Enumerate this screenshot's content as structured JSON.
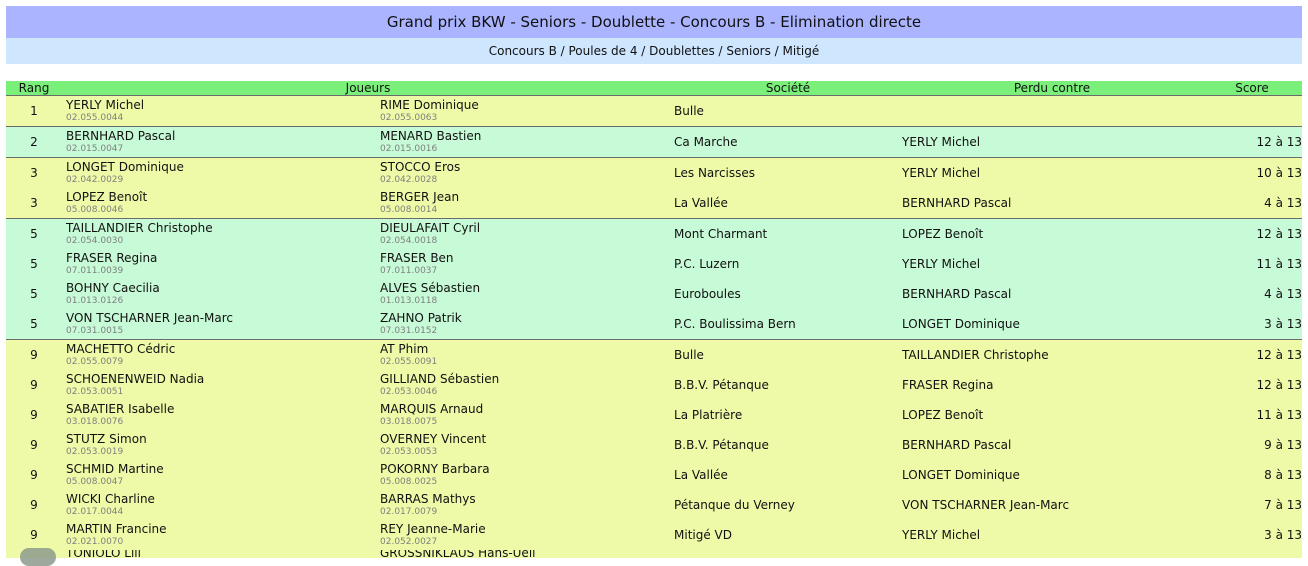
{
  "header": {
    "title": "Grand prix BKW - Seniors - Doublette - Concours B - Elimination directe",
    "subtitle": "Concours B / Poules de 4 / Doublettes / Seniors / Mitigé"
  },
  "columns": {
    "rank": "Rang",
    "players": "Joueurs",
    "club": "Société",
    "lost_to": "Perdu contre",
    "score": "Score"
  },
  "rows": [
    {
      "rank": "1",
      "p1": "YERLY Michel",
      "l1": "02.055.0044",
      "p2": "RIME Dominique",
      "l2": "02.055.0063",
      "club": "Bulle",
      "lost_to": "",
      "score": ""
    },
    {
      "rank": "2",
      "p1": "BERNHARD Pascal",
      "l1": "02.015.0047",
      "p2": "MENARD Bastien",
      "l2": "02.015.0016",
      "club": "Ca Marche",
      "lost_to": "YERLY Michel",
      "score": "12 à 13"
    },
    {
      "rank": "3",
      "p1": "LONGET Dominique",
      "l1": "02.042.0029",
      "p2": "STOCCO Eros",
      "l2": "02.042.0028",
      "club": "Les Narcisses",
      "lost_to": "YERLY Michel",
      "score": "10 à 13"
    },
    {
      "rank": "3",
      "p1": "LOPEZ Benoît",
      "l1": "05.008.0046",
      "p2": "BERGER Jean",
      "l2": "05.008.0014",
      "club": "La Vallée",
      "lost_to": "BERNHARD Pascal",
      "score": "4 à 13"
    },
    {
      "rank": "5",
      "p1": "TAILLANDIER Christophe",
      "l1": "02.054.0030",
      "p2": "DIEULAFAIT Cyril",
      "l2": "02.054.0018",
      "club": "Mont Charmant",
      "lost_to": "LOPEZ Benoît",
      "score": "12 à 13"
    },
    {
      "rank": "5",
      "p1": "FRASER Regina",
      "l1": "07.011.0039",
      "p2": "FRASER Ben",
      "l2": "07.011.0037",
      "club": "P.C. Luzern",
      "lost_to": "YERLY Michel",
      "score": "11 à 13"
    },
    {
      "rank": "5",
      "p1": "BOHNY Caecilia",
      "l1": "01.013.0126",
      "p2": "ALVES Sébastien",
      "l2": "01.013.0118",
      "club": "Euroboules",
      "lost_to": "BERNHARD Pascal",
      "score": "4 à 13"
    },
    {
      "rank": "5",
      "p1": "VON TSCHARNER Jean-Marc",
      "l1": "07.031.0015",
      "p2": "ZAHNO Patrik",
      "l2": "07.031.0152",
      "club": "P.C. Boulissima Bern",
      "lost_to": "LONGET Dominique",
      "score": "3 à 13"
    },
    {
      "rank": "9",
      "p1": "MACHETTO Cédric",
      "l1": "02.055.0079",
      "p2": "AT Phim",
      "l2": "02.055.0091",
      "club": "Bulle",
      "lost_to": "TAILLANDIER Christophe",
      "score": "12 à 13"
    },
    {
      "rank": "9",
      "p1": "SCHOENENWEID Nadia",
      "l1": "02.053.0051",
      "p2": "GILLIAND Sébastien",
      "l2": "02.053.0046",
      "club": "B.B.V. Pétanque",
      "lost_to": "FRASER Regina",
      "score": "12 à 13"
    },
    {
      "rank": "9",
      "p1": "SABATIER Isabelle",
      "l1": "03.018.0076",
      "p2": "MARQUIS Arnaud",
      "l2": "03.018.0075",
      "club": "La Platrière",
      "lost_to": "LOPEZ Benoît",
      "score": "11 à 13"
    },
    {
      "rank": "9",
      "p1": "STUTZ Simon",
      "l1": "02.053.0019",
      "p2": "OVERNEY Vincent",
      "l2": "02.053.0053",
      "club": "B.B.V. Pétanque",
      "lost_to": "BERNHARD Pascal",
      "score": "9 à 13"
    },
    {
      "rank": "9",
      "p1": "SCHMID Martine",
      "l1": "05.008.0047",
      "p2": "POKORNY Barbara",
      "l2": "05.008.0025",
      "club": "La Vallée",
      "lost_to": "LONGET Dominique",
      "score": "8 à 13"
    },
    {
      "rank": "9",
      "p1": "WICKI Charline",
      "l1": "02.017.0044",
      "p2": "BARRAS Mathys",
      "l2": "02.017.0079",
      "club": "Pétanque du Verney",
      "lost_to": "VON TSCHARNER Jean-Marc",
      "score": "7 à 13"
    },
    {
      "rank": "9",
      "p1": "MARTIN Francine",
      "l1": "02.021.0070",
      "p2": "REY Jeanne-Marie",
      "l2": "02.052.0027",
      "club": "Mitigé VD",
      "lost_to": "YERLY Michel",
      "score": "3 à 13"
    }
  ],
  "partial_row": {
    "p1": "TONIOLO Lili",
    "p2": "GROSSNIKLAUS Hans-Ueli"
  }
}
